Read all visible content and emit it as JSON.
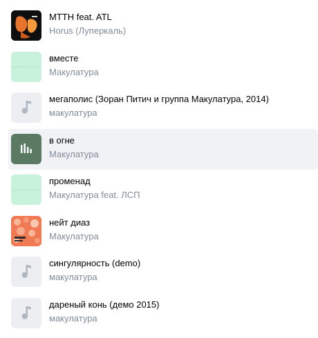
{
  "tracks": [
    {
      "title": "MTTH feat. ATL",
      "artist": "Horus (Луперкаль)",
      "cover": "album-art-dark-orange"
    },
    {
      "title": "вместе",
      "artist": "Макулатура",
      "cover": "album-art-mint"
    },
    {
      "title": "мегаполис (Зоран Питич и группа Макулатура, 2014)",
      "artist": "макулатура",
      "cover": "music-note-icon"
    },
    {
      "title": "в огне",
      "artist": "Макулатура",
      "cover": "equalizer-icon",
      "playing": true
    },
    {
      "title": "променад",
      "artist": "Макулатура feat. ЛСП",
      "cover": "album-art-mint"
    },
    {
      "title": "нейт диаз",
      "artist": "Макулатура",
      "cover": "album-art-orange"
    },
    {
      "title": "сингулярность (demo)",
      "artist": "макулатура",
      "cover": "music-note-icon"
    },
    {
      "title": "дареный конь (демо 2015)",
      "artist": "макулатура",
      "cover": "music-note-icon"
    }
  ],
  "colors": {
    "title": "#000000",
    "artist": "#818c99",
    "active_row_bg": "#f0f2f5",
    "note_cover_bg": "#eceef1",
    "note_glyph": "#aeb7c2",
    "mint_cover_bg": "#c9f2dd",
    "playing_cover_bg": "#5b7a63",
    "orange_cover_bg": "#f07a53"
  }
}
